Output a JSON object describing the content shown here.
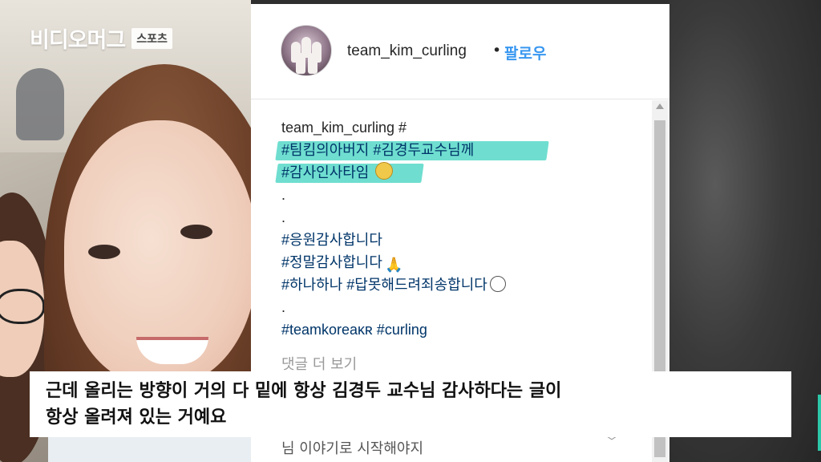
{
  "brand": {
    "logo_text": "비디오머그",
    "badge": "스포츠"
  },
  "post": {
    "username": "team_kim_curling",
    "separator": "•",
    "follow_label": "팔로우",
    "caption_lines": [
      "team_kim_curling #",
      "#팀킴의아버지 #김경두교수님께",
      "#감사인사타임",
      ".",
      ".",
      "#응원감사합니다",
      "#정말감사합니다",
      "#하나하나 #답못해드려죄송합니다",
      ".",
      "#teamkoreaᴋʀ #curling"
    ],
    "more_comments": "댓글 더 보기",
    "partial_comment": "님 이야기로 시작해야지",
    "emoji_icons": [
      "heart-eyes-emoji-icon",
      "praying-hands-emoji-icon",
      "sad-face-emoji-icon"
    ]
  },
  "subtitle": {
    "line1": "근데 올리는 방향이 거의 다 밑에 항상 김경두 교수님 감사하다는 글이",
    "line2": "항상 올려져 있는 거예요"
  },
  "colors": {
    "highlight": "#56d8c8",
    "follow": "#3897f0",
    "accent_bar": "#2cc7a8"
  }
}
